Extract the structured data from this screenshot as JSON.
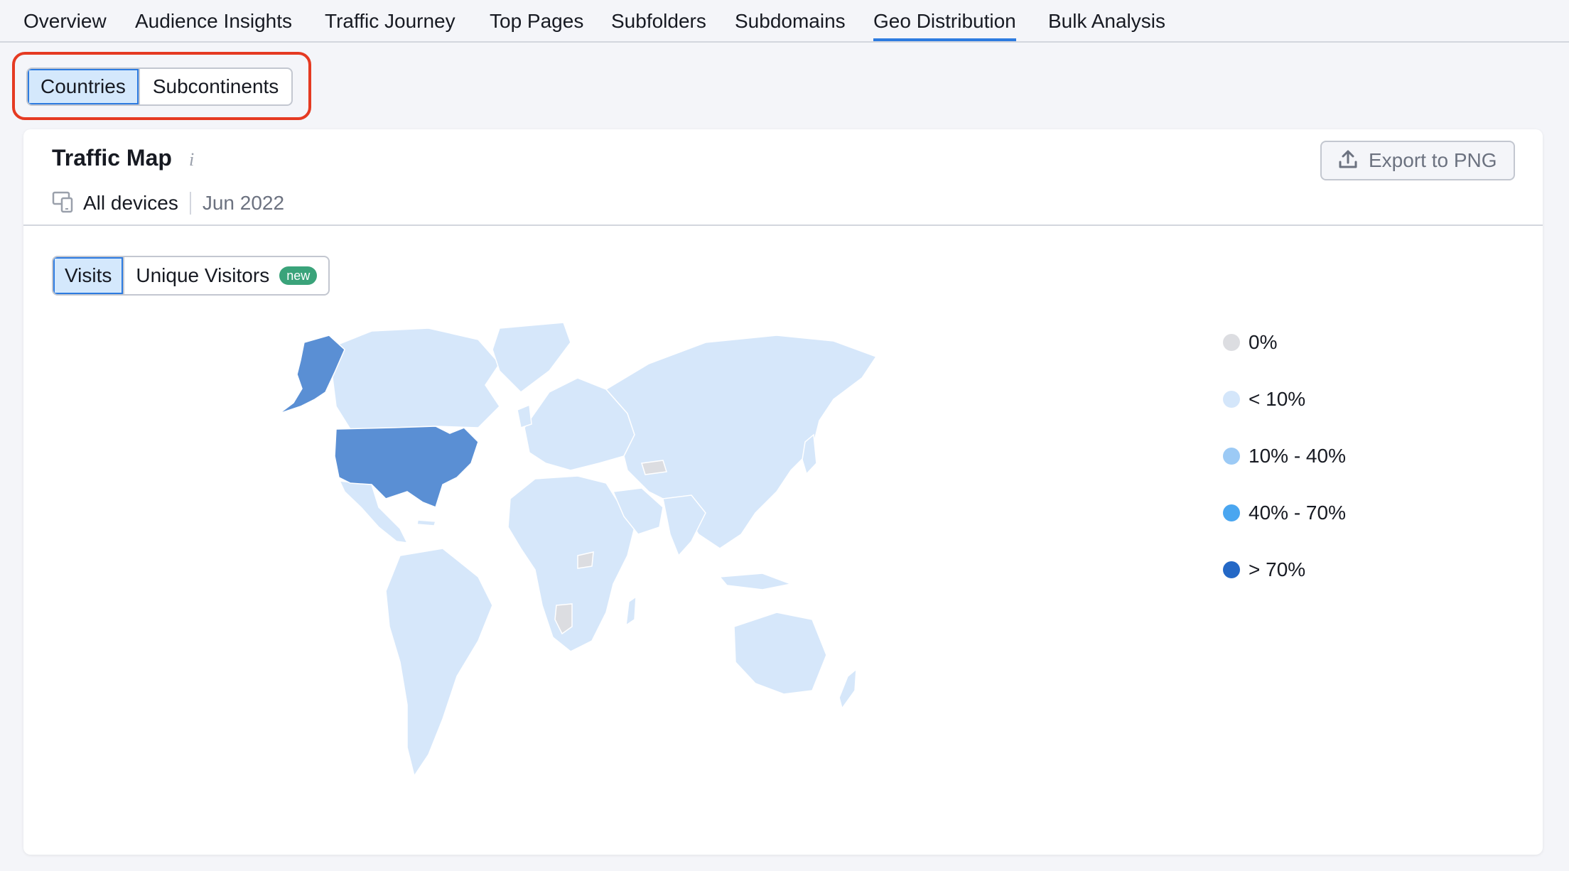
{
  "tabs": [
    "Overview",
    "Audience Insights",
    "Traffic Journey",
    "Top Pages",
    "Subfolders",
    "Subdomains",
    "Geo Distribution",
    "Bulk Analysis"
  ],
  "active_tab": "Geo Distribution",
  "region_toggle": {
    "countries": "Countries",
    "subcontinents": "Subcontinents",
    "selected": "Countries"
  },
  "card": {
    "title": "Traffic Map",
    "info_icon": "i",
    "export_label": "Export to PNG",
    "device": "All devices",
    "date": "Jun 2022"
  },
  "metric_toggle": {
    "visits": "Visits",
    "unique_visitors": "Unique Visitors",
    "badge": "new",
    "selected": "Visits"
  },
  "legend": [
    {
      "label": "0%",
      "color": "#dcdde1"
    },
    {
      "label": "< 10%",
      "color": "#d4e6fa"
    },
    {
      "label": "10% - 40%",
      "color": "#9ccaf5"
    },
    {
      "label": "40% - 70%",
      "color": "#4aa6f0"
    },
    {
      "label": "> 70%",
      "color": "#2468c6"
    }
  ],
  "map_colors": {
    "land": "#d6e7fa",
    "highlight": "#5a8fd4",
    "zero": "#dcdde1"
  },
  "icons": [
    "info-icon",
    "upload-icon",
    "devices-icon"
  ]
}
